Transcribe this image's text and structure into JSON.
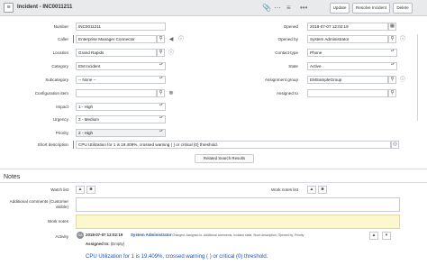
{
  "header": {
    "title": "Incident - INC0011211",
    "update_label": "Update",
    "resolve_label": "Resolve Incident",
    "delete_label": "Delete"
  },
  "form": {
    "number": {
      "label": "Number",
      "value": "INC0011211"
    },
    "caller": {
      "label": "Caller",
      "value": "Enterprise Manager Connector"
    },
    "location": {
      "label": "Location",
      "value": "Grand Rapids"
    },
    "category": {
      "label": "Category",
      "value": "EM Incident"
    },
    "subcategory": {
      "label": "Subcategory",
      "value": "-- None --"
    },
    "configuration_item": {
      "label": "Configuration item",
      "value": ""
    },
    "impact": {
      "label": "Impact",
      "value": "1 - High"
    },
    "urgency": {
      "label": "Urgency",
      "value": "2 - Medium"
    },
    "priority": {
      "label": "Priority",
      "value": "2 - High"
    },
    "short_description": {
      "label": "Short description",
      "value": "CPU Utilization for 1 is 19.409%, crossed warning ( ) or critical (0) threshold."
    },
    "opened": {
      "label": "Opened",
      "value": "2018-07-07 12:02:19"
    },
    "opened_by": {
      "label": "Opened by",
      "value": "System Administrator"
    },
    "contact_type": {
      "label": "Contact type",
      "value": "Phone"
    },
    "state": {
      "label": "State",
      "value": "Active"
    },
    "assignment_group": {
      "label": "Assignment group",
      "value": "EMSampleGroup"
    },
    "assigned_to": {
      "label": "Assigned to",
      "value": ""
    }
  },
  "related_search_label": "Related Search Results",
  "notes": {
    "title": "Notes",
    "watch_list_label": "Watch list",
    "work_notes_list_label": "Work notes list",
    "additional_comments_label": "Additional comments (Customer visible)",
    "work_notes_label": "Work notes",
    "activity_label": "Activity"
  },
  "activity": {
    "avatar_initials": "SA",
    "date": "2018-07-07 12:02:19",
    "user": "System Administrator",
    "changed": "Changed: Assigned to, Additional comments, Incident state, Short description, Opened by, Priority",
    "assigned_to_label": "Assigned to:",
    "assigned_to_value": "(Empty)",
    "text": "CPU Utilization for 1 is 19.409%, crossed warning ( ) or critical (0) threshold."
  },
  "colors": {
    "accent": "#1f57a4",
    "mandatory": "#b7791f",
    "highlight": "#fbf8cf"
  }
}
